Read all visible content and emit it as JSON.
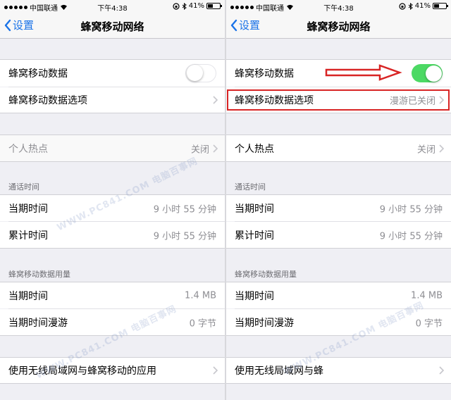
{
  "status": {
    "carrier": "中国联通",
    "time": "下午4:38",
    "battery": "41%",
    "battery_level": 0.41
  },
  "nav": {
    "back_label": "设置",
    "title": "蜂窝移动网络"
  },
  "cellular": {
    "data_label": "蜂窝移动数据",
    "options_label": "蜂窝移动数据选项"
  },
  "hotspot": {
    "label": "个人热点",
    "value": "关闭"
  },
  "call_time": {
    "header": "通话时间",
    "current_label": "当期时间",
    "current_value": "9 小时 55 分钟",
    "total_label": "累计时间",
    "total_value": "9 小时 55 分钟"
  },
  "usage": {
    "header": "蜂窝移动数据用量",
    "current_label": "当期时间",
    "current_value": "1.4 MB",
    "roaming_label": "当期时间漫游",
    "roaming_value": "0 字节"
  },
  "apps": {
    "label": "使用无线局域网与蜂窝移动的应用",
    "label_truncated": "使用无线局域网与蜂"
  },
  "left": {
    "toggle_on": false
  },
  "right": {
    "toggle_on": true,
    "options_value": "漫游已关闭"
  },
  "watermark": {
    "text": "WWW.PC841.COM 电脑百事网"
  },
  "colors": {
    "accent": "#1a73e8",
    "toggle_on": "#4cd964",
    "highlight": "#d82424"
  }
}
